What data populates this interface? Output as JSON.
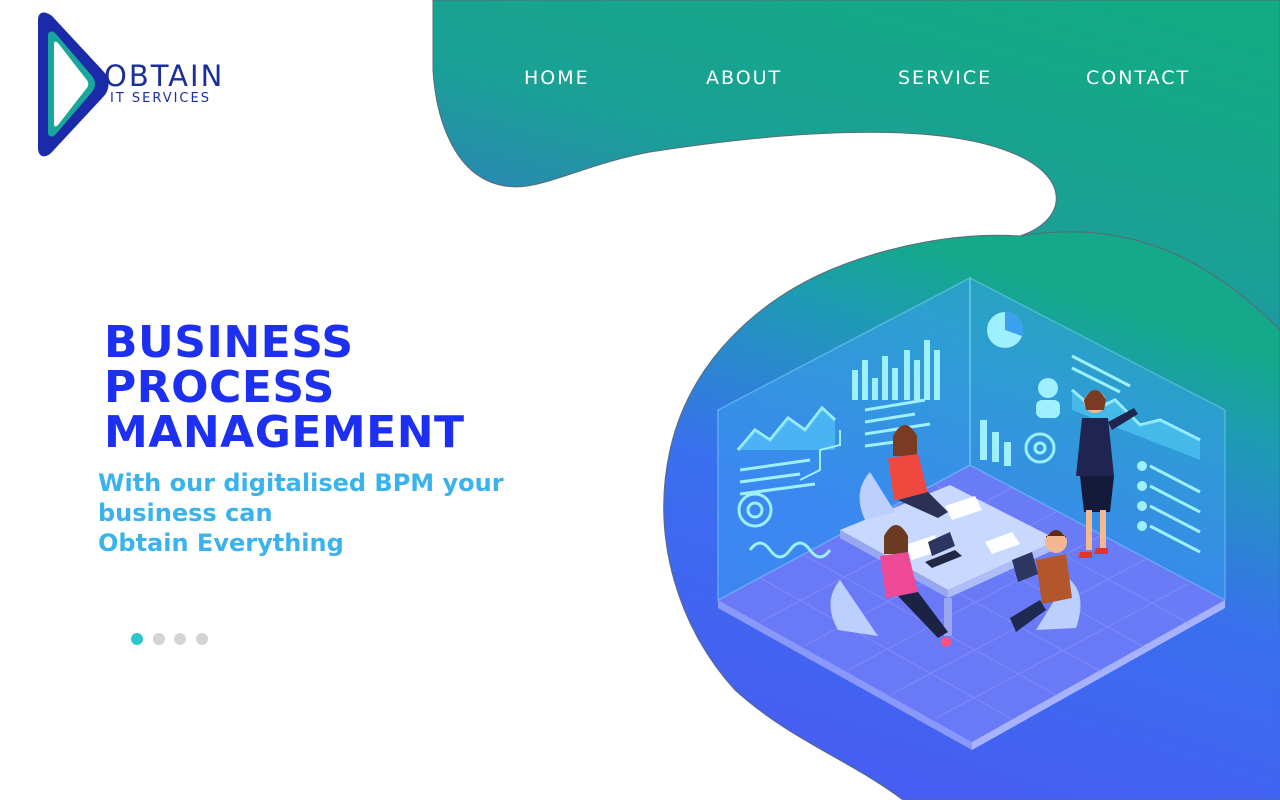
{
  "brand": {
    "name": "OBTAIN",
    "tagline": "IT SERVICES",
    "colors": {
      "primary": "#1d2ff0",
      "accent": "#3ab3ec",
      "gradient_top": "#12ab83",
      "gradient_bottom": "#4a5cf2"
    }
  },
  "nav": {
    "items": [
      {
        "label": "HOME"
      },
      {
        "label": "ABOUT"
      },
      {
        "label": "SERVICE"
      },
      {
        "label": "CONTACT"
      }
    ]
  },
  "hero": {
    "title_lines": [
      "BUSINESS",
      "PROCESS",
      "MANAGEMENT"
    ],
    "subtitle_lines": [
      "With our digitalised BPM your",
      "business can",
      "Obtain Everything"
    ],
    "illustration_icon": "isometric-office-meeting-icon"
  },
  "carousel": {
    "slide_count": 4,
    "active_index": 0,
    "active_color": "#2cc7c9",
    "inactive_color": "#d4d4d4"
  }
}
